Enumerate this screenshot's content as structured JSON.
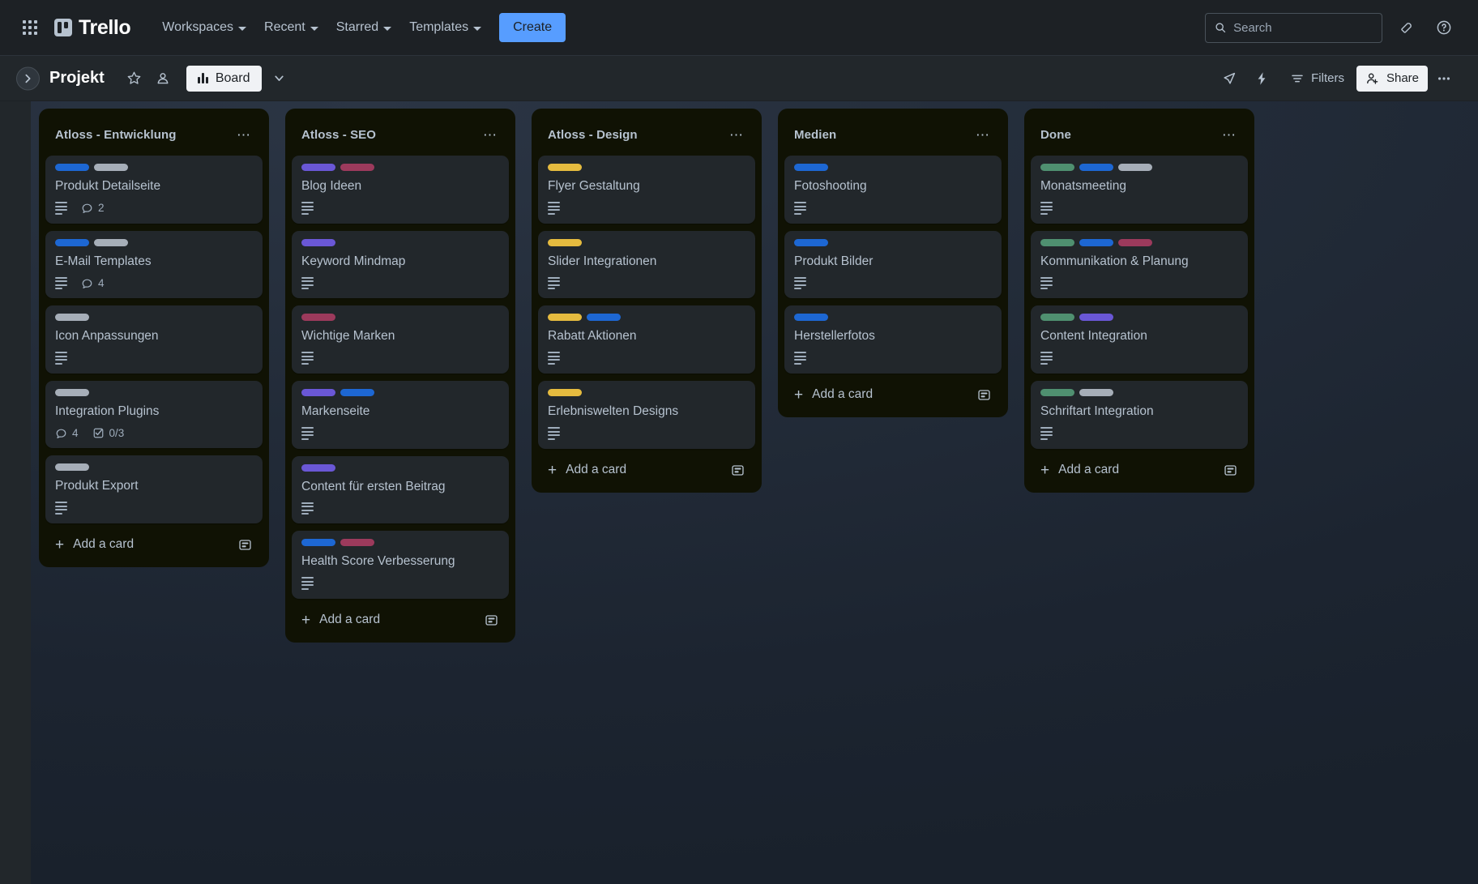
{
  "top_nav": {
    "apps_icon": "apps-grid-icon",
    "brand": "Trello",
    "menus": [
      {
        "label": "Workspaces"
      },
      {
        "label": "Recent"
      },
      {
        "label": "Starred"
      },
      {
        "label": "Templates"
      }
    ],
    "create_label": "Create",
    "search": {
      "placeholder": "Search",
      "value": "",
      "icon": "search-icon"
    },
    "notifications_icon": "bell-icon",
    "help_icon": "help-circle-icon"
  },
  "board_header": {
    "sidebar_toggle_icon": "chevron-right-icon",
    "title": "Projekt",
    "star_icon": "star-icon",
    "visibility_icon": "workspace-visible-icon",
    "view_label": "Board",
    "view_icon": "board-view-icon",
    "view_chevron_icon": "chevron-down-icon",
    "rocket_icon": "rocket-icon",
    "automation_icon": "lightning-bolt-icon",
    "filters_label": "Filters",
    "filters_icon": "filter-icon",
    "share_label": "Share",
    "share_icon": "person-add-icon",
    "overflow_icon": "more-horizontal-icon"
  },
  "label_colors": {
    "blue": "#1d67d3",
    "gray": "#a6aeb8",
    "purple": "#6a57d6",
    "pink": "#9c3a5c",
    "yellow": "#e5bb3f",
    "green": "#4f9070"
  },
  "list_common": {
    "add_card_label": "Add a card",
    "add_plus_icon": "plus-icon",
    "template_icon": "card-template-icon",
    "menu_icon": "list-menu-icon"
  },
  "lists": [
    {
      "title": "Atloss - Entwicklung",
      "cards": [
        {
          "title": "Produkt Detailseite",
          "labels": [
            "blue",
            "gray"
          ],
          "has_description": true,
          "comments": "2",
          "checklist": null
        },
        {
          "title": "E-Mail Templates",
          "labels": [
            "blue",
            "gray"
          ],
          "has_description": true,
          "comments": "4",
          "checklist": null
        },
        {
          "title": "Icon Anpassungen",
          "labels": [
            "gray"
          ],
          "has_description": true,
          "comments": null,
          "checklist": null
        },
        {
          "title": "Integration Plugins",
          "labels": [
            "gray"
          ],
          "has_description": false,
          "comments": "4",
          "checklist": "0/3"
        },
        {
          "title": "Produkt Export",
          "labels": [
            "gray"
          ],
          "has_description": true,
          "comments": null,
          "checklist": null
        }
      ]
    },
    {
      "title": "Atloss - SEO",
      "cards": [
        {
          "title": "Blog Ideen",
          "labels": [
            "purple",
            "pink"
          ],
          "has_description": true,
          "comments": null,
          "checklist": null
        },
        {
          "title": "Keyword Mindmap",
          "labels": [
            "purple"
          ],
          "has_description": true,
          "comments": null,
          "checklist": null
        },
        {
          "title": "Wichtige Marken",
          "labels": [
            "pink"
          ],
          "has_description": true,
          "comments": null,
          "checklist": null
        },
        {
          "title": "Markenseite",
          "labels": [
            "purple",
            "blue"
          ],
          "has_description": true,
          "comments": null,
          "checklist": null
        },
        {
          "title": "Content für ersten Beitrag",
          "labels": [
            "purple"
          ],
          "has_description": true,
          "comments": null,
          "checklist": null
        },
        {
          "title": "Health Score Verbesserung",
          "labels": [
            "blue",
            "pink"
          ],
          "has_description": true,
          "comments": null,
          "checklist": null
        }
      ]
    },
    {
      "title": "Atloss - Design",
      "cards": [
        {
          "title": "Flyer Gestaltung",
          "labels": [
            "yellow"
          ],
          "has_description": true,
          "comments": null,
          "checklist": null
        },
        {
          "title": "Slider Integrationen",
          "labels": [
            "yellow"
          ],
          "has_description": true,
          "comments": null,
          "checklist": null
        },
        {
          "title": "Rabatt Aktionen",
          "labels": [
            "yellow",
            "blue"
          ],
          "has_description": true,
          "comments": null,
          "checklist": null
        },
        {
          "title": "Erlebniswelten Designs",
          "labels": [
            "yellow"
          ],
          "has_description": true,
          "comments": null,
          "checklist": null
        }
      ]
    },
    {
      "title": "Medien",
      "cards": [
        {
          "title": "Fotoshooting",
          "labels": [
            "blue"
          ],
          "has_description": true,
          "comments": null,
          "checklist": null
        },
        {
          "title": "Produkt Bilder",
          "labels": [
            "blue"
          ],
          "has_description": true,
          "comments": null,
          "checklist": null
        },
        {
          "title": "Herstellerfotos",
          "labels": [
            "blue"
          ],
          "has_description": true,
          "comments": null,
          "checklist": null
        }
      ]
    },
    {
      "title": "Done",
      "cards": [
        {
          "title": "Monatsmeeting",
          "labels": [
            "green",
            "blue",
            "gray"
          ],
          "has_description": true,
          "comments": null,
          "checklist": null
        },
        {
          "title": "Kommunikation & Planung",
          "labels": [
            "green",
            "blue",
            "pink"
          ],
          "has_description": true,
          "comments": null,
          "checklist": null
        },
        {
          "title": "Content Integration",
          "labels": [
            "green",
            "purple"
          ],
          "has_description": true,
          "comments": null,
          "checklist": null
        },
        {
          "title": "Schriftart Integration",
          "labels": [
            "green",
            "gray"
          ],
          "has_description": true,
          "comments": null,
          "checklist": null
        }
      ]
    }
  ]
}
